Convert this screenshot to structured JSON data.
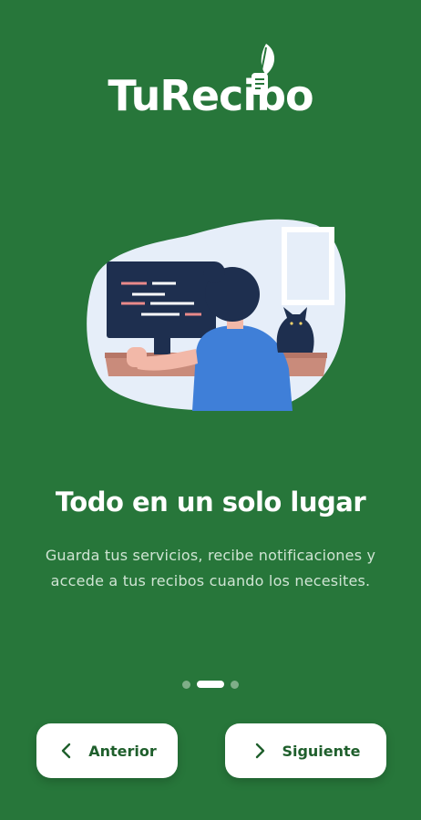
{
  "app": {
    "logo_text": "TuRecib",
    "logo_suffix": "o"
  },
  "onboarding": {
    "title": "Todo en un solo lugar",
    "description": "Guarda tus servicios, recibe notificaciones y accede a tus recibos cuando los necesites.",
    "current_page": 2,
    "total_pages": 3,
    "illustration": "person-coding-with-cat-illustration"
  },
  "navigation": {
    "prev_label": "Anterior",
    "next_label": "Siguiente",
    "prev_icon": "chevron-left-icon",
    "next_icon": "chevron-right-icon"
  },
  "colors": {
    "background": "#27763a",
    "button_bg": "#ffffff",
    "button_text": "#1f5f2c",
    "dot_inactive": "#7fae88",
    "dot_active": "#ffffff"
  }
}
